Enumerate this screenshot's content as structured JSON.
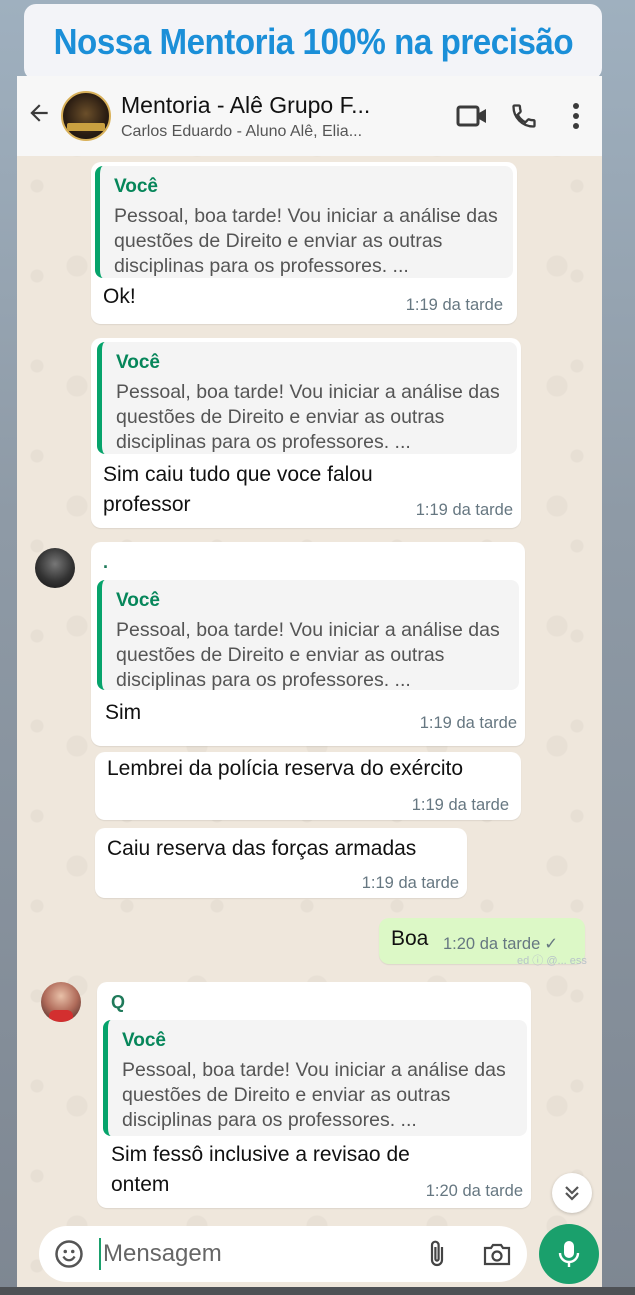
{
  "banner": {
    "text": "Nossa Mentoria 100% na precisão"
  },
  "header": {
    "title": "Mentoria - Alê Grupo F...",
    "subtitle": "Carlos Eduardo - Aluno Alê, Elia...",
    "icons": [
      "back-arrow-icon",
      "video-call-icon",
      "phone-icon",
      "more-vert-icon"
    ]
  },
  "quoted": {
    "author": "Você",
    "text": "Pessoal, boa tarde! Vou iniciar a análise das questões de Direito e enviar as outras disciplinas para os professores. ..."
  },
  "messages": [
    {
      "quote_author": "Você",
      "quote_text": "Pessoal, boa tarde! Vou iniciar a análise das questões de Direito e enviar as outras disciplinas para os professores. ...",
      "text": "Ok!",
      "time": "1:19 da tarde"
    },
    {
      "quote_author": "Você",
      "quote_text": "Pessoal, boa tarde! Vou iniciar a análise das questões de Direito e enviar as outras disciplinas para os professores. ...",
      "text": "Sim caiu tudo que voce falou professor",
      "time": "1:19 da tarde"
    },
    {
      "sender": ".",
      "quote_author": "Você",
      "quote_text": "Pessoal, boa tarde! Vou iniciar a análise das questões de Direito e enviar as outras disciplinas para os professores. ...",
      "text": "Sim",
      "time": "1:19 da tarde"
    },
    {
      "text": "Lembrei da polícia reserva do exército",
      "time": "1:19 da tarde"
    },
    {
      "text": "Caiu reserva das forças armadas",
      "time": "1:19 da tarde"
    },
    {
      "outgoing": true,
      "text": "Boa",
      "time": "1:20 da tarde",
      "status": "✓"
    },
    {
      "sender": "Q",
      "quote_author": "Você",
      "quote_text": "Pessoal, boa tarde! Vou iniciar a análise das questões de Direito e enviar as outras disciplinas para os professores. ...",
      "text": "Sim fessô inclusive a revisao de ontem",
      "time": "1:20 da tarde"
    }
  ],
  "composer": {
    "placeholder": "Mensagem"
  },
  "watermark": "ed ⓘ @... ess"
}
